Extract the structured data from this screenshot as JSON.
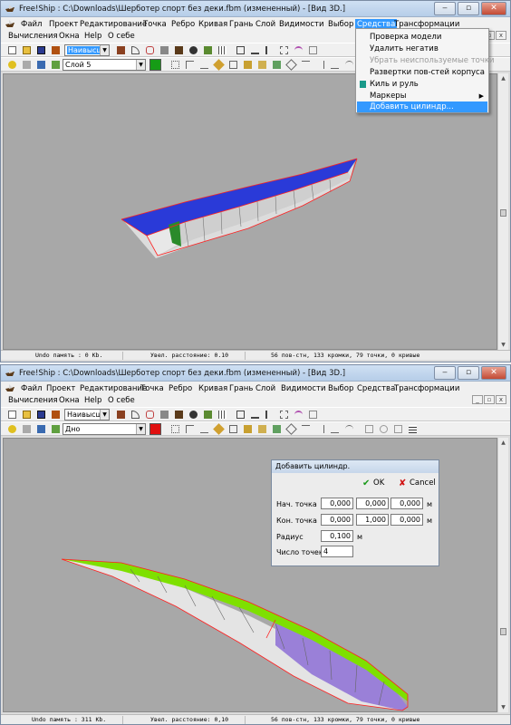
{
  "window1": {
    "title": "Free!Ship : C:\\Downloads\\Шерботер спорт без деки.fbm (измененный) - [Вид 3D.]",
    "menu_row1": [
      "Файл",
      "Проект",
      "Редактирование",
      "Точка",
      "Ребро",
      "Кривая",
      "Грань",
      "Слой",
      "Видимости",
      "Выбор",
      "Средства",
      "Трансформации"
    ],
    "menu_row2": [
      "Вычисления",
      "Окна",
      "Help",
      "О себе"
    ],
    "active_menu": "Средства",
    "view_combo": "Наивысш",
    "layer_combo": "Слой 5",
    "layer_color": "#169c16",
    "dropdown_items": [
      {
        "label": "Проверка модели",
        "disabled": false
      },
      {
        "label": "Удалить негатив",
        "disabled": false
      },
      {
        "label": "Убрать неиспользуемые точки",
        "disabled": true
      },
      {
        "label": "Развертки пов-стей корпуса",
        "disabled": false
      },
      {
        "label": "Киль и руль",
        "disabled": false
      },
      {
        "label": "Маркеры",
        "disabled": false
      },
      {
        "label": "Добавить цилиндр...",
        "disabled": false
      }
    ],
    "status": {
      "undo": "Undo память : 0 Kb.",
      "distance": "Увел. расстояние: 0.10",
      "stats": "56 пов-стн, 133 кромки, 79 точки, 0 кривые"
    }
  },
  "window2": {
    "title": "Free!Ship : C:\\Downloads\\Шерботер спорт без деки.fbm (измененный) - [Вид 3D.]",
    "menu_row1": [
      "Файл",
      "Проект",
      "Редактирование",
      "Точка",
      "Ребро",
      "Кривая",
      "Грань",
      "Слой",
      "Видимости",
      "Выбор",
      "Средства",
      "Трансформации"
    ],
    "menu_row2": [
      "Вычисления",
      "Окна",
      "Help",
      "О себе"
    ],
    "view_combo": "Наивысш",
    "layer_combo": "Дно",
    "layer_color": "#e01010",
    "status": {
      "undo": "Undo память : 311 Kb.",
      "distance": "Увел. расстояние: 0,10",
      "stats": "56 пов-стн, 133 кромки, 79 точки, 0 кривые"
    }
  },
  "dialog": {
    "title": "Добавить цилиндр.",
    "ok": "OK",
    "cancel": "Cancel",
    "start_label": "Нач. точка",
    "start": [
      "0,000",
      "0,000",
      "0,000"
    ],
    "end_label": "Кон. точка",
    "end": [
      "0,000",
      "1,000",
      "0,000"
    ],
    "unit": "м",
    "radius_label": "Радиус",
    "radius": "0,100",
    "points_label": "Число точек",
    "points": "4"
  },
  "colors": {
    "hull_blue": "#2a3ad8",
    "hull_green": "#7ee000",
    "hull_purple": "#9a80d8",
    "hull_grey": "#dcdcdc",
    "edge_red": "#ff2020"
  }
}
